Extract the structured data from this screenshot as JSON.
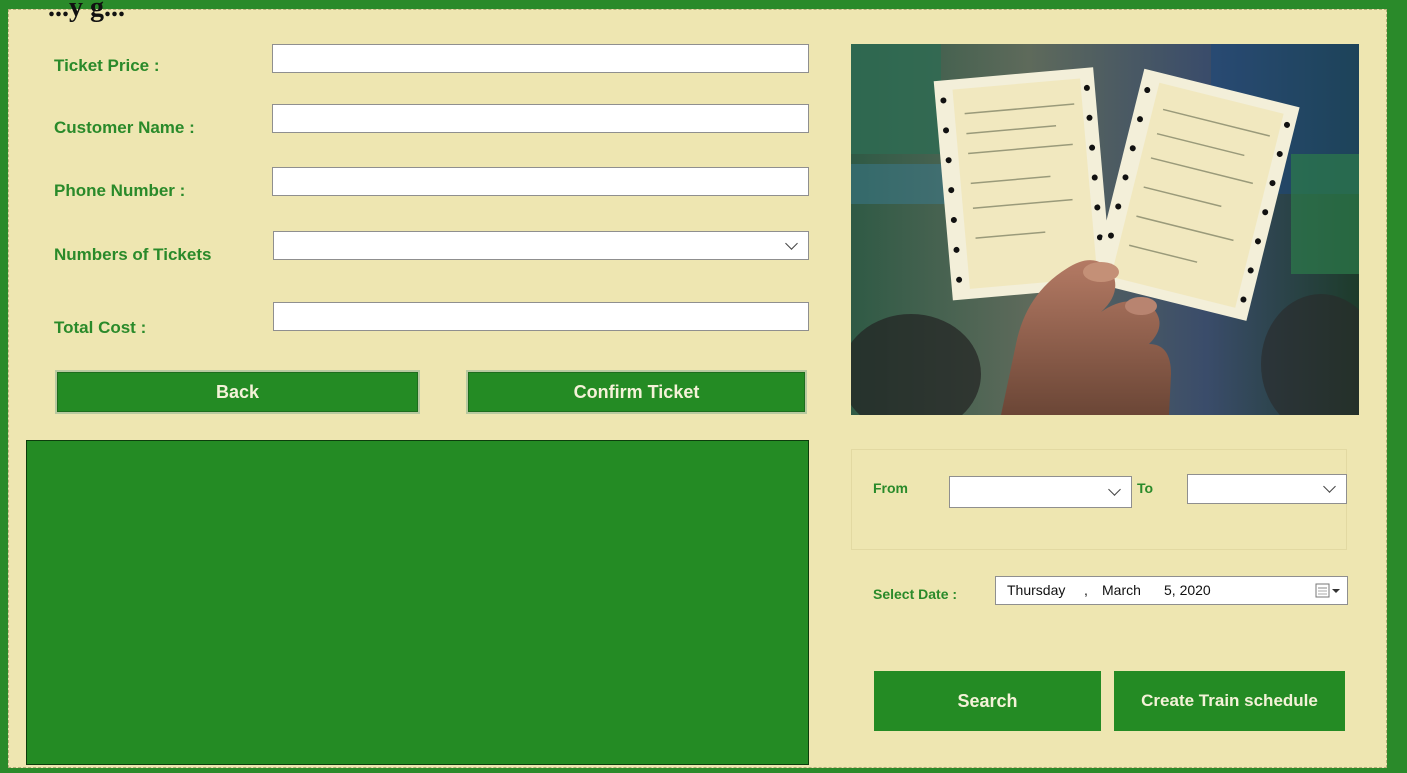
{
  "window": {
    "title_fragment": "...y g..."
  },
  "form": {
    "ticket_price_label": "Ticket Price :",
    "ticket_price_value": "",
    "customer_name_label": "Customer Name :",
    "customer_name_value": "",
    "phone_number_label": "Phone Number :",
    "phone_number_value": "",
    "num_tickets_label": "Numbers of Tickets",
    "num_tickets_value": "",
    "total_cost_label": "Total Cost :",
    "total_cost_value": ""
  },
  "buttons": {
    "back": "Back",
    "confirm": "Confirm Ticket",
    "search": "Search",
    "create_schedule": "Create Train schedule"
  },
  "route": {
    "from_label": "From",
    "from_value": "",
    "to_label": "To",
    "to_value": ""
  },
  "date": {
    "label": "Select Date :",
    "weekday": "Thursday",
    "sep": ",",
    "month": "March",
    "day_year": "5, 2020"
  },
  "colors": {
    "accent_green": "#248b24",
    "panel_bg": "#eee6b1",
    "label_green": "#2a8a2a"
  },
  "icons": {
    "dropdown": "chevron-down-icon",
    "calendar": "calendar-icon"
  }
}
